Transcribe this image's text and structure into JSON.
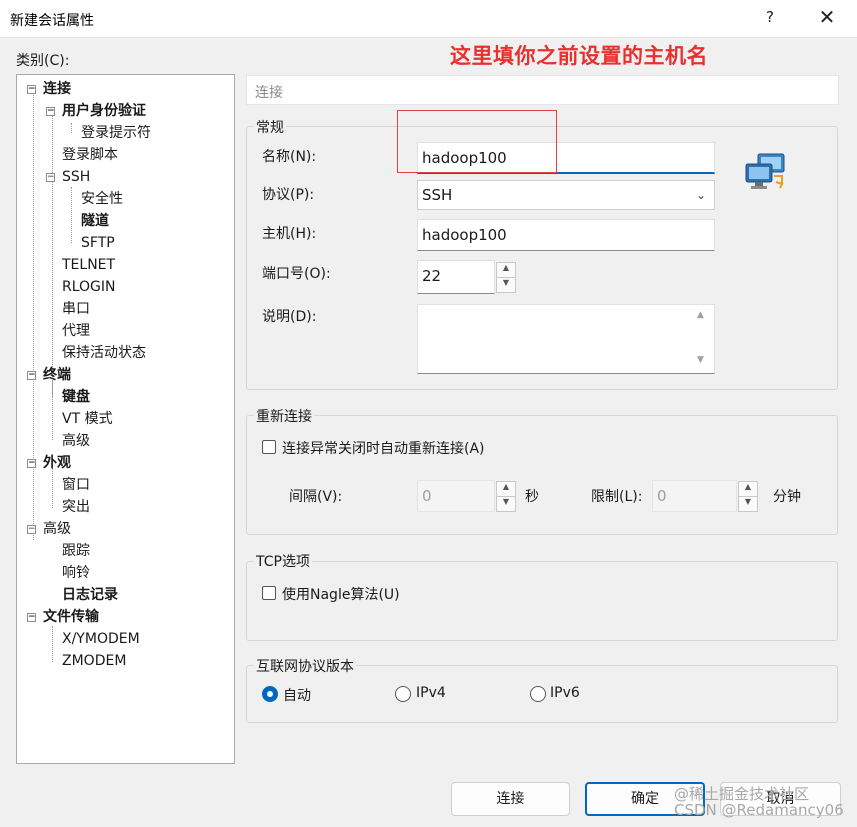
{
  "window": {
    "title": "新建会话属性",
    "help_label": "?",
    "close_label": "✕"
  },
  "annotation": "这里填你之前设置的主机名",
  "category_label": "类别(C):",
  "tree": [
    {
      "label": "连接",
      "bold": true
    },
    {
      "label": "用户身份验证",
      "bold": true
    },
    {
      "label": "登录提示符",
      "bold": false
    },
    {
      "label": "登录脚本",
      "bold": false
    },
    {
      "label": "SSH",
      "bold": false
    },
    {
      "label": "安全性",
      "bold": false
    },
    {
      "label": "隧道",
      "bold": true
    },
    {
      "label": "SFTP",
      "bold": false
    },
    {
      "label": "TELNET",
      "bold": false
    },
    {
      "label": "RLOGIN",
      "bold": false
    },
    {
      "label": "串口",
      "bold": false
    },
    {
      "label": "代理",
      "bold": false
    },
    {
      "label": "保持活动状态",
      "bold": false
    },
    {
      "label": "终端",
      "bold": true
    },
    {
      "label": "键盘",
      "bold": true
    },
    {
      "label": "VT 模式",
      "bold": false
    },
    {
      "label": "高级",
      "bold": false
    },
    {
      "label": "外观",
      "bold": true
    },
    {
      "label": "窗口",
      "bold": false
    },
    {
      "label": "突出",
      "bold": false
    },
    {
      "label": "高级",
      "bold": false
    },
    {
      "label": "跟踪",
      "bold": false
    },
    {
      "label": "响铃",
      "bold": false
    },
    {
      "label": "日志记录",
      "bold": true
    },
    {
      "label": "文件传输",
      "bold": true
    },
    {
      "label": "X/YMODEM",
      "bold": false
    },
    {
      "label": "ZMODEM",
      "bold": false
    }
  ],
  "section_header": "连接",
  "general": {
    "title": "常规",
    "name_label": "名称(N):",
    "name_value": "hadoop100",
    "protocol_label": "协议(P):",
    "protocol_value": "SSH",
    "host_label": "主机(H):",
    "host_value": "hadoop100",
    "port_label": "端口号(O):",
    "port_value": "22",
    "desc_label": "说明(D):",
    "desc_value": ""
  },
  "reconnect": {
    "title": "重新连接",
    "checkbox_label": "连接异常关闭时自动重新连接(A)",
    "checked": false,
    "interval_label": "间隔(V):",
    "interval_value": "0",
    "interval_unit": "秒",
    "limit_label": "限制(L):",
    "limit_value": "0",
    "limit_unit": "分钟"
  },
  "tcp": {
    "title": "TCP选项",
    "nagle_label": "使用Nagle算法(U)",
    "checked": false
  },
  "ip_version": {
    "title": "互联网协议版本",
    "options": [
      "自动",
      "IPv4",
      "IPv6"
    ],
    "selected": "自动"
  },
  "buttons": {
    "connect": "连接",
    "ok": "确定",
    "cancel": "取消"
  },
  "watermark": {
    "line1": "@稀土掘金技术社区",
    "line2": "CSDN @Redamancy06"
  }
}
